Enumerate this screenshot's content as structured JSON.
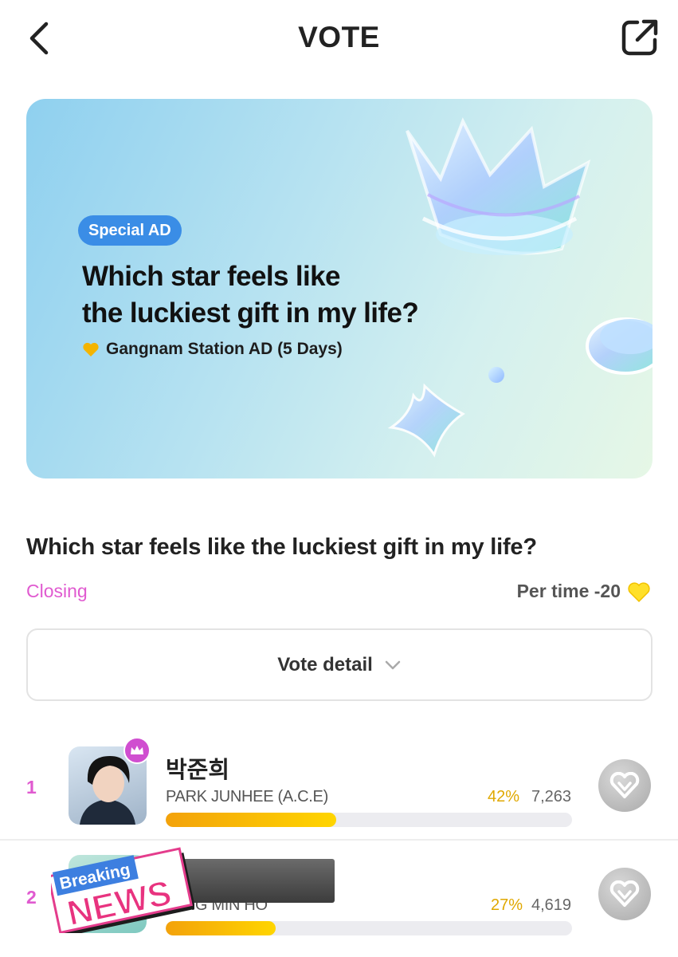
{
  "header": {
    "title": "VOTE",
    "back_icon": "chevron-left-icon",
    "share_icon": "share-icon"
  },
  "banner": {
    "tag": "Special AD",
    "headline_line1": "Which star feels like",
    "headline_line2": "the luckiest gift in my life?",
    "subtitle": "Gangnam Station AD (5 Days)",
    "subtitle_icon": "yellow-heart-icon"
  },
  "vote": {
    "title": "Which star feels like the luckiest gift in my life?",
    "status": "Closing",
    "per_time": "Per time -20",
    "per_time_icon": "yellow-heart-icon",
    "detail_label": "Vote detail"
  },
  "candidates": [
    {
      "rank": "1",
      "name_ko": "박준희",
      "name_en": "PARK JUNHEE (A.C.E)",
      "percent": "42%",
      "votes": "7,263",
      "share": 0.42,
      "badge": "crown-icon"
    },
    {
      "rank": "2",
      "name_ko": "",
      "name_en": "JANG MIN HO",
      "percent": "27%",
      "votes": "4,619",
      "share": 0.27
    }
  ],
  "sticker": {
    "line1": "Breaking",
    "line2": "NEWS"
  },
  "colors": {
    "accent_pink": "#e05ad0",
    "bar_orange": "#f3a20b",
    "bar_yellow": "#ffd500",
    "tag_blue": "#3a8de6"
  }
}
